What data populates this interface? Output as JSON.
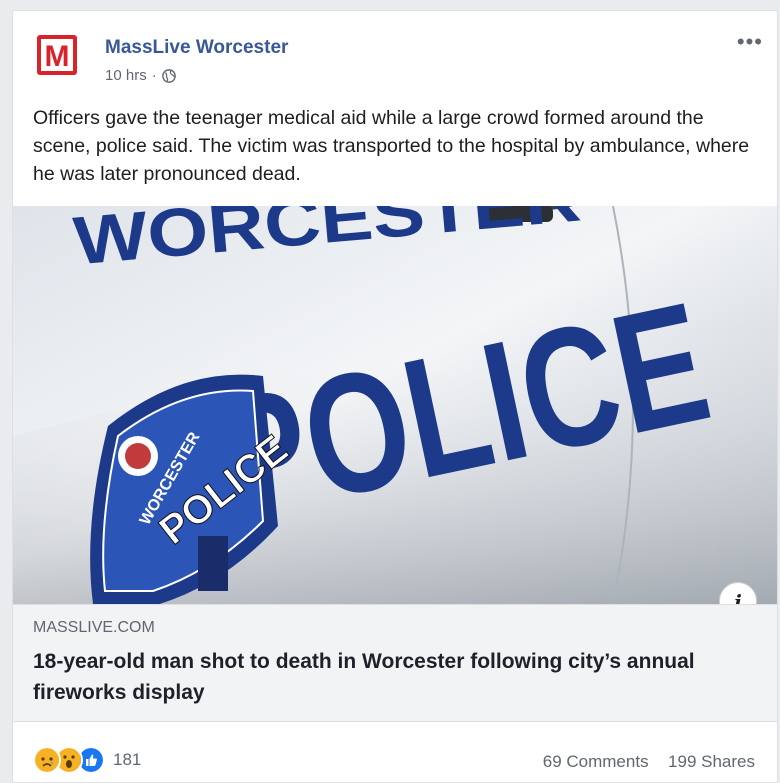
{
  "post": {
    "page_name": "MassLive Worcester",
    "time": "10 hrs",
    "separator": "·",
    "privacy_icon": "globe-icon",
    "more_label": "•••",
    "text": "Officers gave the teenager medical aid while a large crowd formed around the scene, police said. The victim was transported to the hospital by ambulance, where he was later pronounced dead."
  },
  "logo": {
    "letter": "M",
    "color": "#d8232a"
  },
  "photo": {
    "car_text_top": "WORCESTER",
    "car_text_main": "POLICE",
    "badge_top": "WORCESTER",
    "badge_main": "POLICE",
    "info_label": "i"
  },
  "link": {
    "domain": "MASSLIVE.COM",
    "title": "18-year-old man shot to death in Worcester following city’s annual fireworks display"
  },
  "engagement": {
    "reactions": [
      "sad",
      "wow",
      "like"
    ],
    "reaction_count": "181",
    "comments": "69 Comments",
    "shares": "199 Shares"
  },
  "colors": {
    "link_blue": "#385898",
    "police_blue": "#1d3a8a",
    "like_blue": "#1877f2"
  }
}
